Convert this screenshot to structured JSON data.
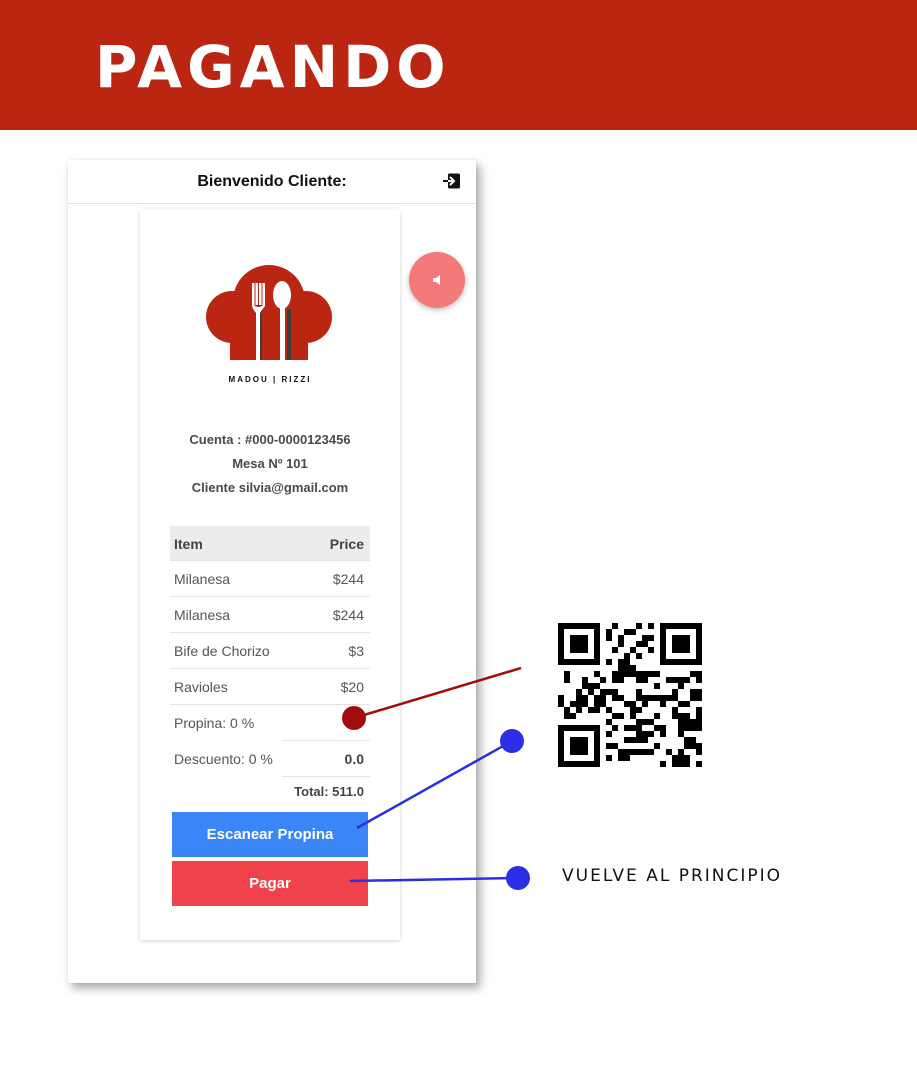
{
  "banner": {
    "title": "PAGANDO"
  },
  "header": {
    "welcome": "Bienvenido Cliente:"
  },
  "brand": {
    "name": "MADOU | RIZZI"
  },
  "account": {
    "cuenta": "Cuenta : #000-0000123456",
    "mesa": "Mesa Nº 101",
    "cliente": "Cliente silvia@gmail.com"
  },
  "bill": {
    "columns": [
      "Item",
      "Price"
    ],
    "rows": [
      {
        "item": "Milanesa",
        "price": "$244"
      },
      {
        "item": "Milanesa",
        "price": "$244"
      },
      {
        "item": "Bife de Chorizo",
        "price": "$3"
      },
      {
        "item": "Ravioles",
        "price": "$20"
      }
    ],
    "tip_label": "Propina: 0 %",
    "discount_label": "Descuento: 0 %",
    "discount_value": "0.0",
    "total": "Total: 511.0"
  },
  "buttons": {
    "scan": "Escanear Propina",
    "pay": "Pagar"
  },
  "annotation": {
    "back_label": "VUELVE AL PRINCIPIO"
  },
  "colors": {
    "banner": "#bb2613",
    "scan_button": "#3a86f6",
    "pay_button": "#f0424a",
    "sound_button": "#f47a7a",
    "tip_marker": "#a30c0c",
    "annotation_blue": "#2b2ee6"
  },
  "icons": {
    "logout": "logout-icon",
    "sound": "speaker-icon",
    "logo": "chef-hat-cutlery-logo"
  }
}
